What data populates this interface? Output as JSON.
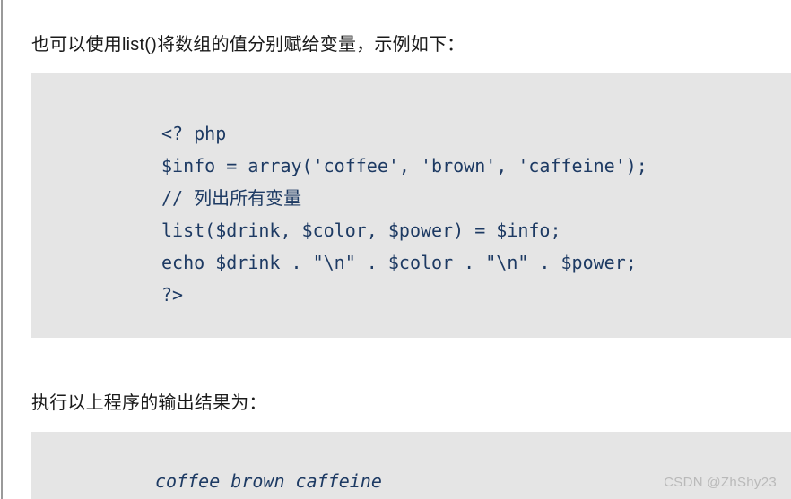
{
  "page": {
    "background_color": "#ffffff",
    "code_background_color": "#e5e5e5",
    "code_text_color": "#1d3a63",
    "prose_text_color": "#1a1a1a"
  },
  "prose": {
    "intro": "也可以使用list()将数组的值分别赋给变量，示例如下：",
    "result_label": "执行以上程序的输出结果为："
  },
  "code_block": {
    "language": "php",
    "lines": [
      "<? php",
      "$info = array('coffee', 'brown', 'caffeine');",
      "// 列出所有变量",
      "list($drink, $color, $power) = $info;",
      "echo $drink . \"\\n\" . $color . \"\\n\" . $power;",
      "?>"
    ]
  },
  "output_block": {
    "lines": [
      "coffee brown caffeine"
    ]
  },
  "watermark": {
    "text": "CSDN @ZhShy23"
  }
}
